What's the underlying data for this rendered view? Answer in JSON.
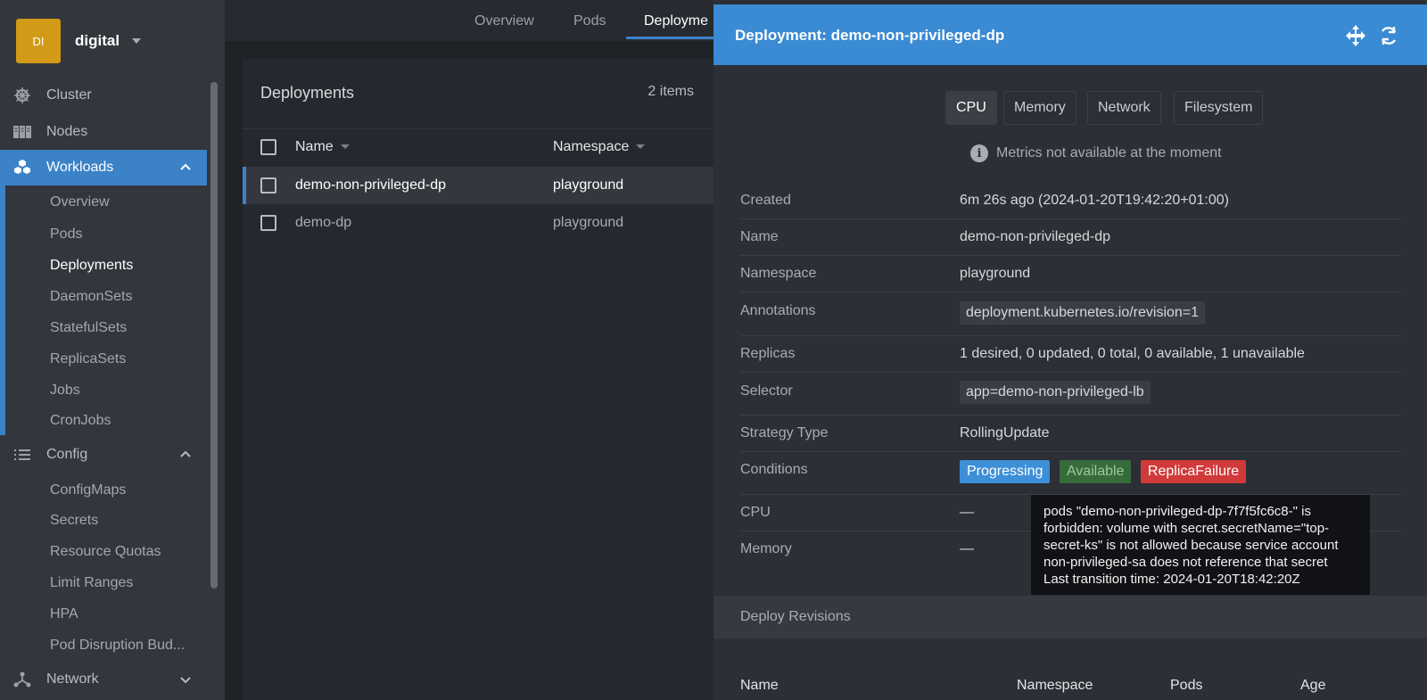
{
  "cluster": {
    "initials": "DI",
    "name": "digital"
  },
  "sidebar": {
    "items": [
      {
        "label": "Cluster"
      },
      {
        "label": "Nodes"
      },
      {
        "label": "Workloads"
      },
      {
        "label": "Config"
      },
      {
        "label": "Network"
      }
    ],
    "workloads_sub": [
      "Overview",
      "Pods",
      "Deployments",
      "DaemonSets",
      "StatefulSets",
      "ReplicaSets",
      "Jobs",
      "CronJobs"
    ],
    "config_sub": [
      "ConfigMaps",
      "Secrets",
      "Resource Quotas",
      "Limit Ranges",
      "HPA",
      "Pod Disruption Bud..."
    ]
  },
  "top_tabs": [
    "Overview",
    "Pods",
    "Deployme"
  ],
  "list": {
    "title": "Deployments",
    "count": "2 items",
    "columns": [
      "Name",
      "Namespace"
    ],
    "rows": [
      {
        "name": "demo-non-privileged-dp",
        "namespace": "playground"
      },
      {
        "name": "demo-dp",
        "namespace": "playground"
      }
    ]
  },
  "drawer": {
    "title": "Deployment: demo-non-privileged-dp",
    "metric_tabs": [
      "CPU",
      "Memory",
      "Network",
      "Filesystem"
    ],
    "metrics_note": "Metrics not available at the moment",
    "details": {
      "created_label": "Created",
      "created_value": "6m 26s ago (2024-01-20T19:42:20+01:00)",
      "name_label": "Name",
      "name_value": "demo-non-privileged-dp",
      "namespace_label": "Namespace",
      "namespace_value": "playground",
      "annotations_label": "Annotations",
      "annotations_value": "deployment.kubernetes.io/revision=1",
      "replicas_label": "Replicas",
      "replicas_value": "1 desired, 0 updated, 0 total, 0 available, 1 unavailable",
      "selector_label": "Selector",
      "selector_value": "app=demo-non-privileged-lb",
      "strategy_label": "Strategy Type",
      "strategy_value": "RollingUpdate",
      "conditions_label": "Conditions",
      "conditions": [
        "Progressing",
        "Available",
        "ReplicaFailure"
      ],
      "cpu_label": "CPU",
      "cpu_value": "—",
      "memory_label": "Memory",
      "memory_value": "—"
    },
    "revisions_title": "Deploy Revisions",
    "revision_columns": [
      "Name",
      "Namespace",
      "Pods",
      "Age"
    ]
  },
  "tooltip": {
    "lines": [
      "pods \"demo-non-privileged-dp-7f7f5fc6c8-\" is",
      "forbidden: volume with secret.secretName=\"top-",
      "secret-ks\" is not allowed because service account",
      "non-privileged-sa does not reference that secret",
      "Last transition time: 2024-01-20T18:42:20Z"
    ]
  },
  "colors": {
    "accent": "#3b82c7",
    "header": "#3a8ad4",
    "danger": "#d03a3a",
    "success": "#366b3c"
  }
}
